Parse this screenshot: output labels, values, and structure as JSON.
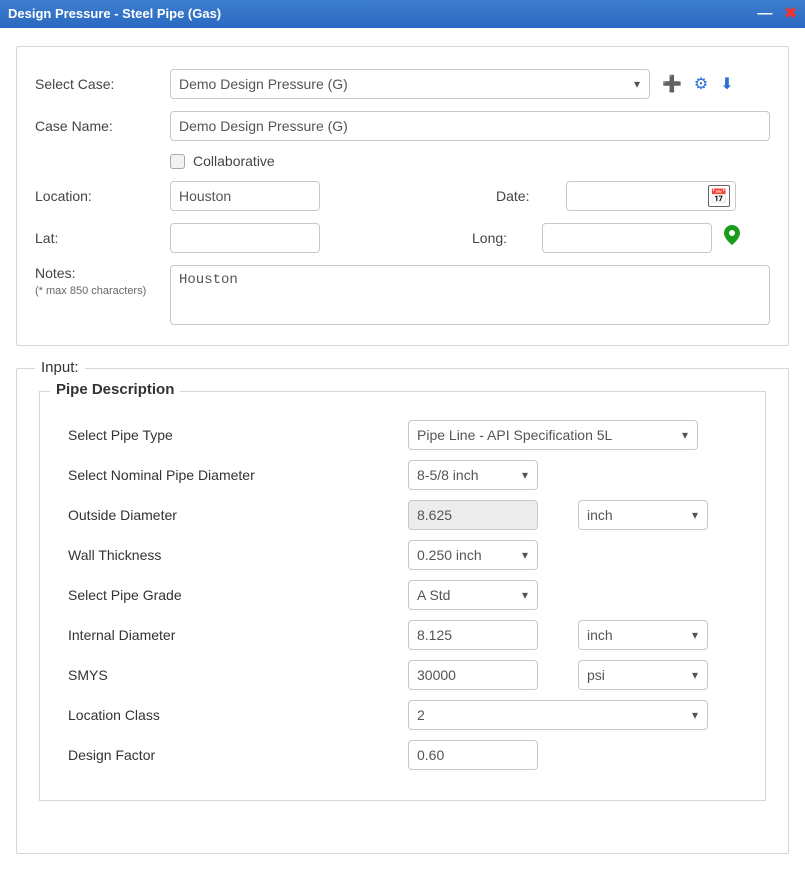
{
  "title": "Design Pressure - Steel Pipe (Gas)",
  "case": {
    "select_label": "Select Case:",
    "selected": "Demo Design Pressure (G)",
    "name_label": "Case Name:",
    "name_value": "Demo Design Pressure (G)",
    "collab_label": "Collaborative",
    "location_label": "Location:",
    "location_value": "Houston",
    "date_label": "Date:",
    "date_value": "",
    "lat_label": "Lat:",
    "lat_value": "",
    "long_label": "Long:",
    "long_value": "",
    "notes_label": "Notes:",
    "notes_hint": "(* max 850 characters)",
    "notes_value": "Houston"
  },
  "input": {
    "legend": "Input:",
    "pipe": {
      "legend": "Pipe Description",
      "type_label": "Select Pipe Type",
      "type_value": "Pipe Line - API Specification 5L",
      "nom_label": "Select Nominal Pipe Diameter",
      "nom_value": "8-5/8 inch",
      "od_label": "Outside Diameter",
      "od_value": "8.625",
      "od_unit": "inch",
      "wall_label": "Wall Thickness",
      "wall_value": "0.250 inch",
      "grade_label": "Select Pipe Grade",
      "grade_value": "A Std",
      "id_label": "Internal Diameter",
      "id_value": "8.125",
      "id_unit": "inch",
      "smys_label": "SMYS",
      "smys_value": "30000",
      "smys_unit": "psi",
      "lclass_label": "Location Class",
      "lclass_value": "2",
      "df_label": "Design Factor",
      "df_value": "0.60"
    }
  }
}
